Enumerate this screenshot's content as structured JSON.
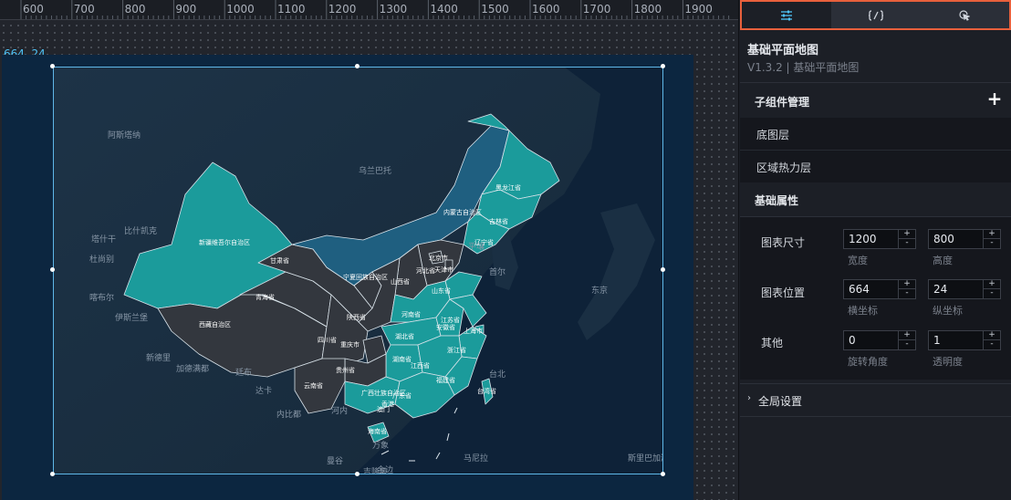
{
  "ruler": {
    "ticks": [
      "600",
      "700",
      "800",
      "900",
      "1000",
      "1100",
      "1200",
      "1300",
      "1400",
      "1500",
      "1600",
      "1700",
      "1800",
      "1900"
    ]
  },
  "canvas": {
    "coord_label": "664, 24"
  },
  "map": {
    "neighbors": [
      "阿斯塔纳",
      "乌兰巴托",
      "比什凯克",
      "塔什干",
      "杜尚别",
      "喀布尔",
      "伊斯兰堡",
      "新德里",
      "加德满都",
      "廷布",
      "达卡",
      "内比都",
      "河内",
      "万象",
      "曼谷",
      "金边",
      "首尔",
      "平壤",
      "东京",
      "马尼拉",
      "台北",
      "吉隆坡",
      "斯里巴加湾市"
    ],
    "provinces": [
      "新疆维吾尔自治区",
      "西藏自治区",
      "青海省",
      "甘肃省",
      "宁夏回族自治区",
      "内蒙古自治区",
      "黑龙江省",
      "吉林省",
      "辽宁省",
      "北京市",
      "天津市",
      "河北省",
      "山西省",
      "陕西省",
      "山东省",
      "河南省",
      "四川省",
      "重庆市",
      "湖北省",
      "安徽省",
      "江苏省",
      "上海市",
      "浙江省",
      "湖南省",
      "江西省",
      "贵州省",
      "云南省",
      "广西壮族自治区",
      "广东省",
      "福建省",
      "台湾省",
      "海南省",
      "香港",
      "澳门"
    ],
    "colors": {
      "teal": "#1b9b9b",
      "dark": "#33373e",
      "blue": "#1f5f80",
      "bg": "#0c2640"
    }
  },
  "panel": {
    "tabs": [
      {
        "name": "config",
        "icon": "sliders-icon"
      },
      {
        "name": "data",
        "icon": "code-icon"
      },
      {
        "name": "interaction",
        "icon": "cursor-click-icon"
      }
    ],
    "title": "基础平面地图",
    "version": "V1.3.2 | 基础平面地图",
    "subcomponents": {
      "label": "子组件管理",
      "add": "+",
      "items": [
        "底图层",
        "区域热力层"
      ]
    },
    "basic": {
      "label": "基础属性",
      "size": {
        "label": "图表尺寸",
        "width": "1200",
        "height": "800",
        "width_label": "宽度",
        "height_label": "高度"
      },
      "position": {
        "label": "图表位置",
        "x": "664",
        "y": "24",
        "x_label": "横坐标",
        "y_label": "纵坐标"
      },
      "other": {
        "label": "其他",
        "rotation": "0",
        "opacity": "1",
        "rotation_label": "旋转角度",
        "opacity_label": "透明度"
      },
      "step_up": "+",
      "step_down": "-"
    },
    "global": {
      "label": "全局设置",
      "arrow": "›"
    }
  }
}
